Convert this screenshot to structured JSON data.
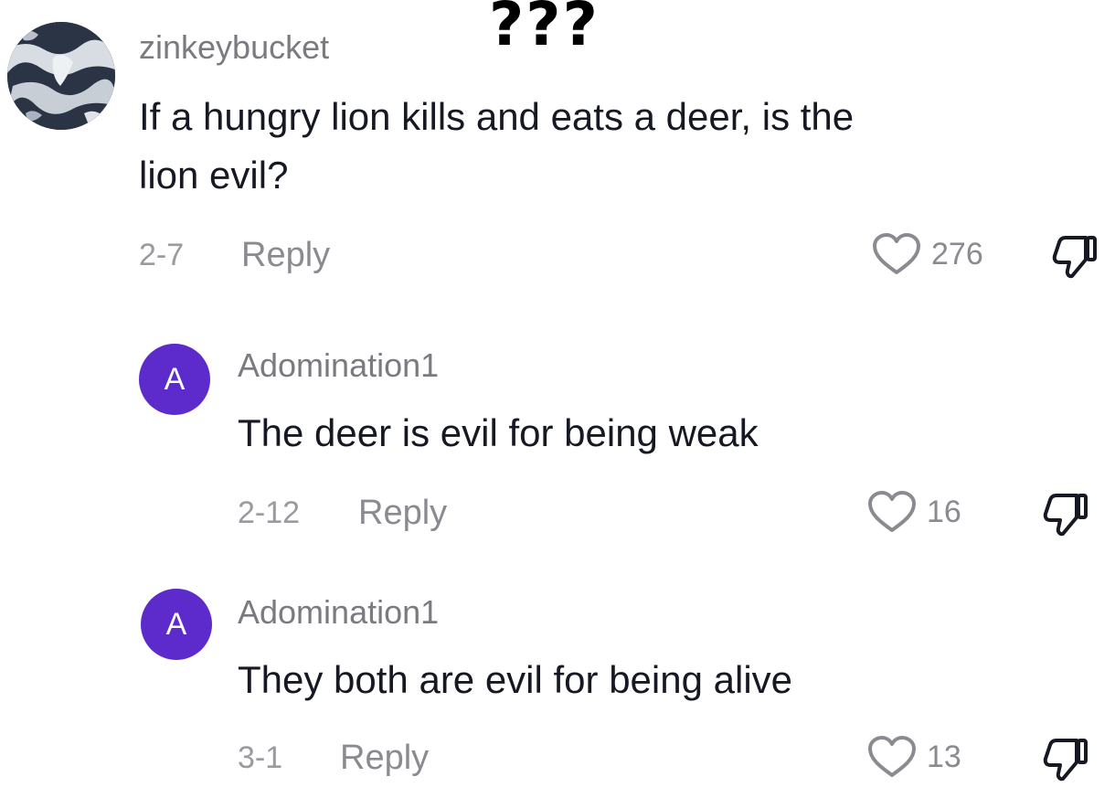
{
  "overlay_caption": "???",
  "comments": [
    {
      "username": "zinkeybucket",
      "text_lines": [
        "If a hungry lion kills and eats a deer, is the",
        "lion evil?"
      ],
      "date": "2-7",
      "reply_label": "Reply",
      "likes": "276",
      "avatar_letter": ""
    },
    {
      "username": "Adomination1",
      "text_lines": [
        "The deer is evil for being weak"
      ],
      "date": "2-12",
      "reply_label": "Reply",
      "likes": "16",
      "avatar_letter": "A"
    },
    {
      "username": "Adomination1",
      "text_lines": [
        "They both are evil for being alive"
      ],
      "date": "3-1",
      "reply_label": "Reply",
      "likes": "13",
      "avatar_letter": "A"
    }
  ],
  "colors": {
    "avatar_purple": "#5d2bcc",
    "text_primary": "#161823",
    "text_secondary": "#8a8a90"
  },
  "icons": {
    "like": "heart-outline-icon",
    "dislike": "thumbs-down-icon"
  }
}
